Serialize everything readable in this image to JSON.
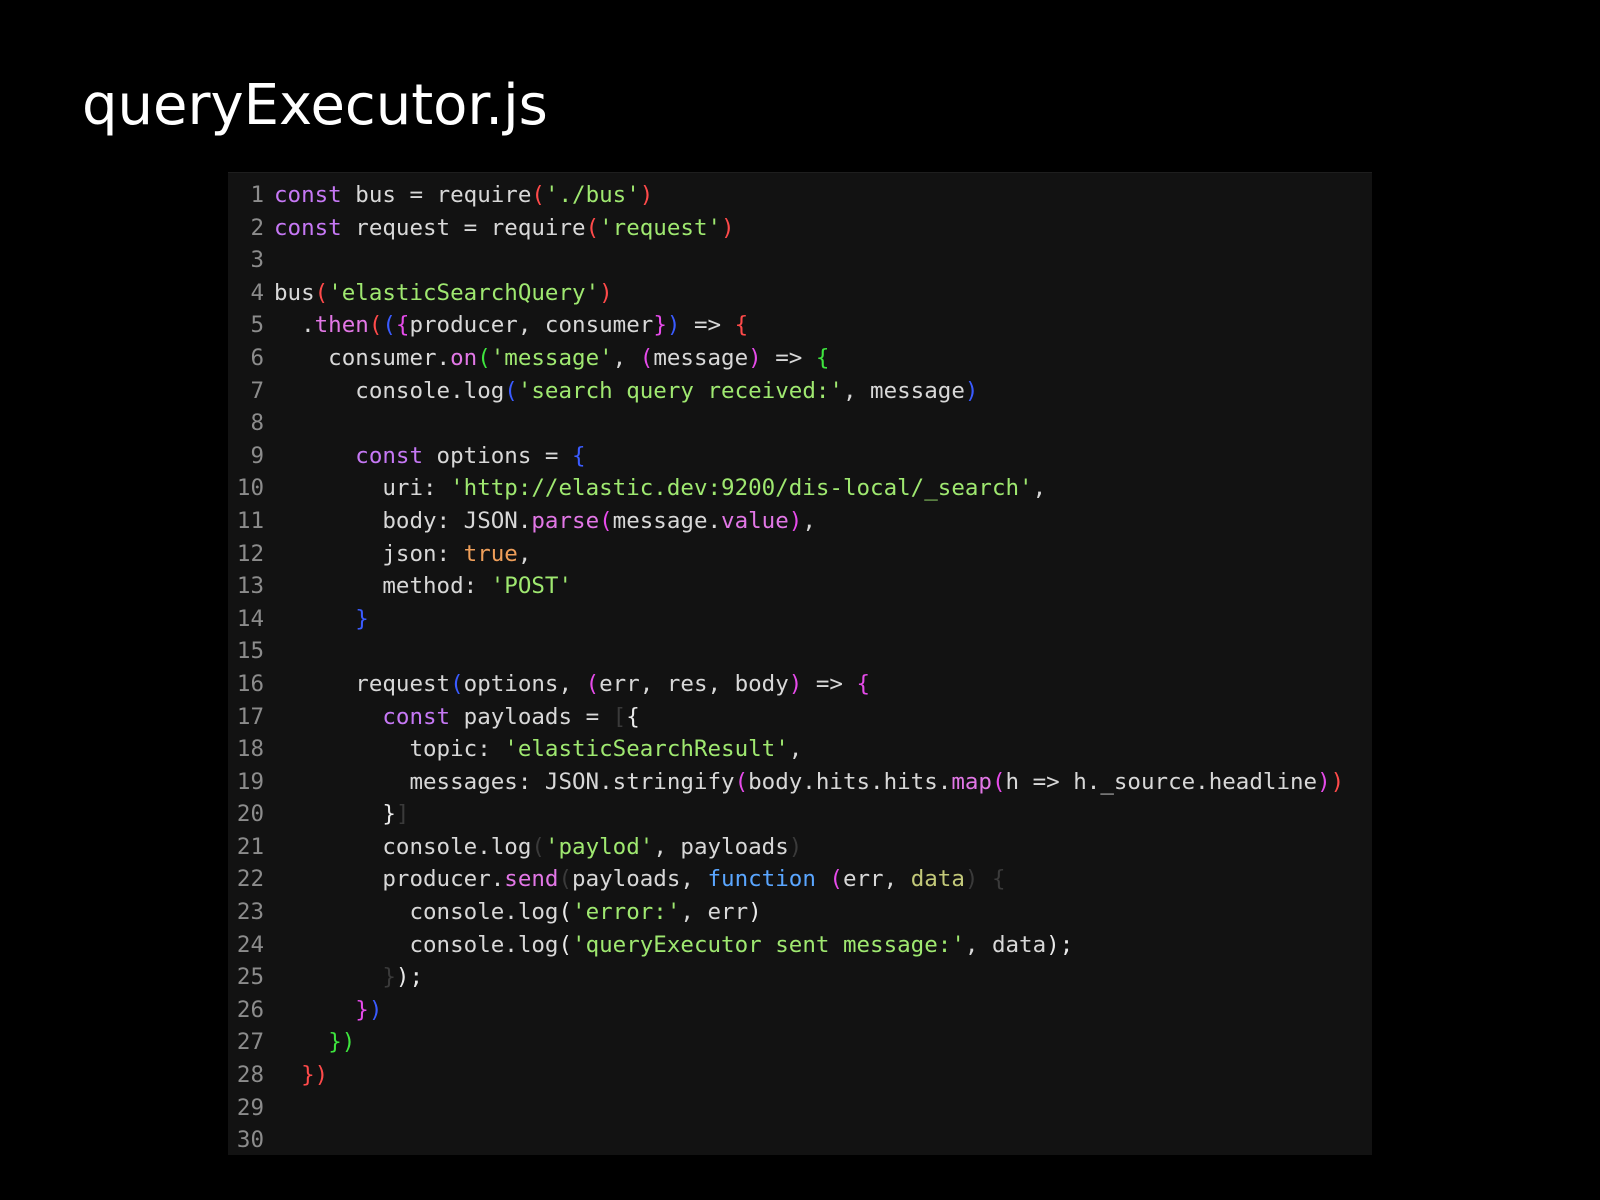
{
  "slide": {
    "title": "queryExecutor.js"
  },
  "editor": {
    "background": "#121212",
    "line_number_color": "#8c8c8c",
    "lines": [
      {
        "n": "1",
        "tokens": [
          [
            "const",
            "kw"
          ],
          [
            " bus = ",
            "id"
          ],
          [
            "require",
            "id"
          ],
          [
            "(",
            "b-red"
          ],
          [
            "'./bus'",
            "str"
          ],
          [
            ")",
            "b-red"
          ]
        ]
      },
      {
        "n": "2",
        "tokens": [
          [
            "const",
            "kw"
          ],
          [
            " request = ",
            "id"
          ],
          [
            "require",
            "id"
          ],
          [
            "(",
            "b-red"
          ],
          [
            "'request'",
            "str"
          ],
          [
            ")",
            "b-red"
          ]
        ]
      },
      {
        "n": "3",
        "tokens": []
      },
      {
        "n": "4",
        "tokens": [
          [
            "bus",
            "id"
          ],
          [
            "(",
            "b-red"
          ],
          [
            "'elasticSearchQuery'",
            "str"
          ],
          [
            ")",
            "b-red"
          ]
        ]
      },
      {
        "n": "5",
        "tokens": [
          [
            "  .",
            "id"
          ],
          [
            "then",
            "fn"
          ],
          [
            "(",
            "b-red"
          ],
          [
            "(",
            "b-blue"
          ],
          [
            "{",
            "b-mag"
          ],
          [
            "producer, consumer",
            "id"
          ],
          [
            "}",
            "b-mag"
          ],
          [
            ")",
            "b-blue"
          ],
          [
            " => ",
            "id"
          ],
          [
            "{",
            "b-red"
          ]
        ]
      },
      {
        "n": "6",
        "tokens": [
          [
            "    consumer.",
            "id"
          ],
          [
            "on",
            "fn"
          ],
          [
            "(",
            "b-green"
          ],
          [
            "'message'",
            "str"
          ],
          [
            ", ",
            "id"
          ],
          [
            "(",
            "b-mag"
          ],
          [
            "message",
            "id"
          ],
          [
            ")",
            "b-mag"
          ],
          [
            " => ",
            "id"
          ],
          [
            "{",
            "b-green"
          ]
        ]
      },
      {
        "n": "7",
        "tokens": [
          [
            "      console.",
            "id"
          ],
          [
            "log",
            "id"
          ],
          [
            "(",
            "b-blue"
          ],
          [
            "'search query received:'",
            "str"
          ],
          [
            ", message",
            "id"
          ],
          [
            ")",
            "b-blue"
          ]
        ]
      },
      {
        "n": "8",
        "tokens": []
      },
      {
        "n": "9",
        "tokens": [
          [
            "      ",
            "id"
          ],
          [
            "const",
            "kw"
          ],
          [
            " options = ",
            "id"
          ],
          [
            "{",
            "b-blue"
          ]
        ]
      },
      {
        "n": "10",
        "tokens": [
          [
            "        uri: ",
            "id"
          ],
          [
            "'http://elastic.dev:9200/dis-local/_search'",
            "str"
          ],
          [
            ",",
            "id"
          ]
        ]
      },
      {
        "n": "11",
        "tokens": [
          [
            "        body: JSON.",
            "id"
          ],
          [
            "parse",
            "fn"
          ],
          [
            "(",
            "b-mag"
          ],
          [
            "message.",
            "id"
          ],
          [
            "value",
            "fn"
          ],
          [
            ")",
            "b-mag"
          ],
          [
            ",",
            "id"
          ]
        ]
      },
      {
        "n": "12",
        "tokens": [
          [
            "        json: ",
            "id"
          ],
          [
            "true",
            "true"
          ],
          [
            ",",
            "id"
          ]
        ]
      },
      {
        "n": "13",
        "tokens": [
          [
            "        method: ",
            "id"
          ],
          [
            "'POST'",
            "str"
          ]
        ]
      },
      {
        "n": "14",
        "tokens": [
          [
            "      ",
            "id"
          ],
          [
            "}",
            "b-blue"
          ]
        ]
      },
      {
        "n": "15",
        "tokens": []
      },
      {
        "n": "16",
        "tokens": [
          [
            "      request",
            "id"
          ],
          [
            "(",
            "b-blue"
          ],
          [
            "options, ",
            "id"
          ],
          [
            "(",
            "b-mag"
          ],
          [
            "err, res, body",
            "id"
          ],
          [
            ")",
            "b-mag"
          ],
          [
            " => ",
            "id"
          ],
          [
            "{",
            "b-mag"
          ]
        ]
      },
      {
        "n": "17",
        "tokens": [
          [
            "        ",
            "id"
          ],
          [
            "const",
            "kw"
          ],
          [
            " payloads = ",
            "id"
          ],
          [
            "[",
            "dim"
          ],
          [
            "{",
            "b-white"
          ]
        ]
      },
      {
        "n": "18",
        "tokens": [
          [
            "          topic: ",
            "id"
          ],
          [
            "'elasticSearchResult'",
            "str"
          ],
          [
            ",",
            "id"
          ]
        ]
      },
      {
        "n": "19",
        "tokens": [
          [
            "          messages: JSON.",
            "id"
          ],
          [
            "stringify",
            "id"
          ],
          [
            "(",
            "b-mag"
          ],
          [
            "body.hits.hits.",
            "id"
          ],
          [
            "map",
            "fn"
          ],
          [
            "(",
            "b-mag"
          ],
          [
            "h => h._source.headline",
            "id"
          ],
          [
            ")",
            "b-mag"
          ],
          [
            ")",
            "b-red"
          ]
        ]
      },
      {
        "n": "20",
        "tokens": [
          [
            "        ",
            "id"
          ],
          [
            "}",
            "b-white"
          ],
          [
            "]",
            "dim"
          ]
        ]
      },
      {
        "n": "21",
        "tokens": [
          [
            "        console.",
            "id"
          ],
          [
            "log",
            "id"
          ],
          [
            "(",
            "dim"
          ],
          [
            "'paylod'",
            "str"
          ],
          [
            ", payloads",
            "id"
          ],
          [
            ")",
            "dim"
          ]
        ]
      },
      {
        "n": "22",
        "tokens": [
          [
            "        producer.",
            "id"
          ],
          [
            "send",
            "fn"
          ],
          [
            "(",
            "dim"
          ],
          [
            "payloads, ",
            "id"
          ],
          [
            "function",
            "function"
          ],
          [
            " ",
            "id"
          ],
          [
            "(",
            "b-mag"
          ],
          [
            "err, ",
            "id"
          ],
          [
            "data",
            "param"
          ],
          [
            ")",
            "dim"
          ],
          [
            " {",
            "dim"
          ]
        ]
      },
      {
        "n": "23",
        "tokens": [
          [
            "          console.",
            "id"
          ],
          [
            "log",
            "id"
          ],
          [
            "(",
            "b-white"
          ],
          [
            "'error:'",
            "str"
          ],
          [
            ", err",
            "id"
          ],
          [
            ")",
            "b-white"
          ]
        ]
      },
      {
        "n": "24",
        "tokens": [
          [
            "          console.",
            "id"
          ],
          [
            "log",
            "id"
          ],
          [
            "(",
            "b-white"
          ],
          [
            "'queryExecutor sent message:'",
            "str"
          ],
          [
            ", data",
            "id"
          ],
          [
            ");",
            "b-white"
          ]
        ]
      },
      {
        "n": "25",
        "tokens": [
          [
            "        ",
            "id"
          ],
          [
            "}",
            "dim"
          ],
          [
            ");",
            "b-white"
          ]
        ]
      },
      {
        "n": "26",
        "tokens": [
          [
            "      ",
            "id"
          ],
          [
            "}",
            "b-mag"
          ],
          [
            ")",
            "b-blue"
          ]
        ]
      },
      {
        "n": "27",
        "tokens": [
          [
            "    ",
            "id"
          ],
          [
            "}",
            "b-green"
          ],
          [
            ")",
            "b-green"
          ]
        ]
      },
      {
        "n": "28",
        "tokens": [
          [
            "  ",
            "id"
          ],
          [
            "}",
            "b-red"
          ],
          [
            ")",
            "b-red"
          ]
        ]
      },
      {
        "n": "29",
        "tokens": []
      },
      {
        "n": "30",
        "tokens": []
      }
    ]
  }
}
